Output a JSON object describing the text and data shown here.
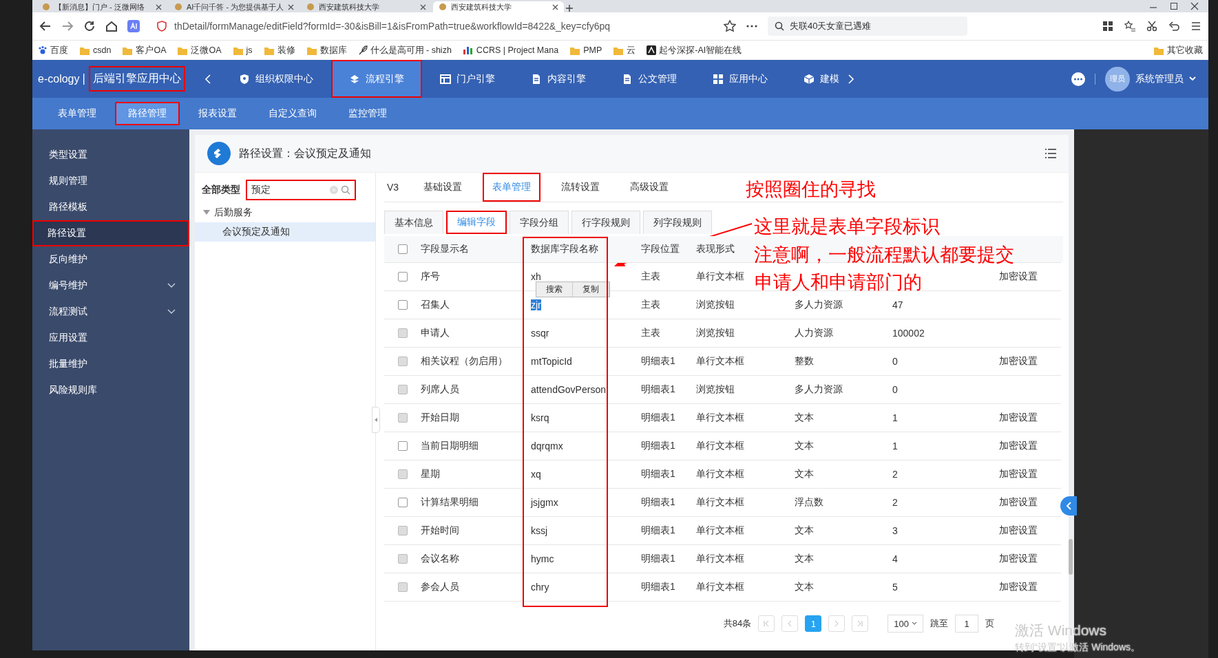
{
  "browser": {
    "tabs": [
      {
        "title": "【新消息】门户 - 泛微网络",
        "selected": false
      },
      {
        "title": "AI千问千答 - 为您提供基于人",
        "selected": false
      },
      {
        "title": "西安建筑科技大学",
        "selected": false
      },
      {
        "title": "西安建筑科技大学",
        "selected": true
      }
    ],
    "address": "thDetail/formManage/editField?formId=-30&isBill=1&isFromPath=true&workflowId=8422&_key=cfy6pq",
    "search": "失联40天女童已遇难",
    "bookmarks": [
      "百度",
      "csdn",
      "客户OA",
      "泛微OA",
      "js",
      "装修",
      "数据库",
      "什么是高可用 - shizh",
      "CCRS | Project Mana",
      "PMP",
      "云",
      "起兮深探-AI智能在线"
    ],
    "other_bookmarks": "其它收藏"
  },
  "app": {
    "brand": "e-cology",
    "center": "后端引擎应用中心",
    "center_circled": true,
    "nav": [
      {
        "label": "组织权限中心",
        "selected": false,
        "circled": false
      },
      {
        "label": "流程引擎",
        "selected": true,
        "circled": true
      },
      {
        "label": "门户引擎",
        "selected": false,
        "circled": false
      },
      {
        "label": "内容引擎",
        "selected": false,
        "circled": false
      },
      {
        "label": "公文管理",
        "selected": false,
        "circled": false
      },
      {
        "label": "应用中心",
        "selected": false,
        "circled": false
      },
      {
        "label": "建模",
        "selected": false,
        "circled": false
      }
    ],
    "avatar": "理员",
    "user": "系统管理员"
  },
  "subnav": [
    {
      "label": "表单管理",
      "selected": false,
      "circled": false
    },
    {
      "label": "路径管理",
      "selected": true,
      "circled": true
    },
    {
      "label": "报表设置",
      "selected": false,
      "circled": false
    },
    {
      "label": "自定义查询",
      "selected": false,
      "circled": false
    },
    {
      "label": "监控管理",
      "selected": false,
      "circled": false
    }
  ],
  "sidebar": [
    {
      "label": "类型设置",
      "selected": false,
      "expandable": false,
      "circled": false
    },
    {
      "label": "规则管理",
      "selected": false,
      "expandable": false,
      "circled": false
    },
    {
      "label": "路径模板",
      "selected": false,
      "expandable": false,
      "circled": false
    },
    {
      "label": "路径设置",
      "selected": true,
      "expandable": false,
      "circled": true
    },
    {
      "label": "反向维护",
      "selected": false,
      "expandable": false,
      "circled": false
    },
    {
      "label": "编号维护",
      "selected": false,
      "expandable": true,
      "circled": false
    },
    {
      "label": "流程测试",
      "selected": false,
      "expandable": true,
      "circled": false
    },
    {
      "label": "应用设置",
      "selected": false,
      "expandable": false,
      "circled": false
    },
    {
      "label": "批量维护",
      "selected": false,
      "expandable": false,
      "circled": false
    },
    {
      "label": "风险规则库",
      "selected": false,
      "expandable": false,
      "circled": false
    }
  ],
  "page_title": "路径设置：会议预定及通知",
  "tree": {
    "label": "全部类型",
    "search": "预定",
    "search_circled": true,
    "nodes": [
      {
        "label": "后勤服务",
        "expanded": true,
        "selected": false,
        "children": [
          {
            "label": "会议预定及通知",
            "selected": true
          }
        ]
      }
    ]
  },
  "version": "V3",
  "tabs": [
    {
      "label": "基础设置",
      "selected": false,
      "circled": false
    },
    {
      "label": "表单管理",
      "selected": true,
      "circled": true
    },
    {
      "label": "流转设置",
      "selected": false,
      "circled": false
    },
    {
      "label": "高级设置",
      "selected": false,
      "circled": false
    }
  ],
  "subtabs": [
    {
      "label": "基本信息",
      "selected": false,
      "circled": false
    },
    {
      "label": "编辑字段",
      "selected": true,
      "circled": true
    },
    {
      "label": "字段分组",
      "selected": false,
      "circled": false
    },
    {
      "label": "行字段规则",
      "selected": false,
      "circled": false
    },
    {
      "label": "列字段规则",
      "selected": false,
      "circled": false
    }
  ],
  "table": {
    "select_all": false,
    "columns": [
      {
        "label": "字段显示名",
        "circled": false
      },
      {
        "label": "数据库字段名称",
        "circled": true
      },
      {
        "label": "字段位置",
        "circled": false
      },
      {
        "label": "表现形式",
        "circled": false
      }
    ],
    "rows": [
      {
        "name": "序号",
        "db": "xh",
        "position": "主表",
        "form": "单行文本框",
        "action": "加密设置",
        "disabled": false,
        "text_selected": false
      },
      {
        "name": "召集人",
        "db": "zjr",
        "position": "主表",
        "form": "浏览按钮",
        "type": "多人力资源",
        "default": "47",
        "disabled": false,
        "text_selected": true
      },
      {
        "name": "申请人",
        "db": "ssqr",
        "position": "主表",
        "form": "浏览按钮",
        "type": "人力资源",
        "default": "100002",
        "disabled": true,
        "text_selected": false
      },
      {
        "name": "相关议程（勿启用）",
        "db": "mtTopicId",
        "position": "明细表1",
        "form": "单行文本框",
        "type": "整数",
        "default": "0",
        "action": "加密设置",
        "disabled": true,
        "text_selected": false
      },
      {
        "name": "列席人员",
        "db": "attendGovPerson",
        "position": "明细表1",
        "form": "浏览按钮",
        "type": "多人力资源",
        "default": "0",
        "disabled": true,
        "text_selected": false
      },
      {
        "name": "开始日期",
        "db": "ksrq",
        "position": "明细表1",
        "form": "单行文本框",
        "type": "文本",
        "default": "1",
        "action": "加密设置",
        "disabled": true,
        "text_selected": false
      },
      {
        "name": "当前日期明细",
        "db": "dqrqmx",
        "position": "明细表1",
        "form": "单行文本框",
        "type": "文本",
        "default": "1",
        "action": "加密设置",
        "disabled": false,
        "text_selected": false
      },
      {
        "name": "星期",
        "db": "xq",
        "position": "明细表1",
        "form": "单行文本框",
        "type": "文本",
        "default": "2",
        "action": "加密设置",
        "disabled": true,
        "text_selected": false
      },
      {
        "name": "计算结果明细",
        "db": "jsjgmx",
        "position": "明细表1",
        "form": "单行文本框",
        "type": "浮点数",
        "default": "2",
        "action": "加密设置",
        "disabled": false,
        "text_selected": false
      },
      {
        "name": "开始时间",
        "db": "kssj",
        "position": "明细表1",
        "form": "单行文本框",
        "type": "文本",
        "default": "3",
        "action": "加密设置",
        "disabled": true,
        "text_selected": false
      },
      {
        "name": "会议名称",
        "db": "hymc",
        "position": "明细表1",
        "form": "单行文本框",
        "type": "文本",
        "default": "4",
        "action": "加密设置",
        "disabled": true,
        "text_selected": false
      },
      {
        "name": "参会人员",
        "db": "chry",
        "position": "明细表1",
        "form": "单行文本框",
        "type": "文本",
        "default": "5",
        "action": "加密设置",
        "disabled": true,
        "text_selected": false
      }
    ]
  },
  "context_menu": [
    "搜索",
    "复制"
  ],
  "pagination": {
    "total": "共84条",
    "pages": [
      {
        "label": "1",
        "selected": true
      }
    ],
    "page_size": "100",
    "jump_label": "跳至",
    "jump_value": "1",
    "page_unit": "页"
  },
  "annotations": [
    "按照圈住的寻找",
    "这里就是表单字段标识",
    "注意啊，一般流程默认都要提交",
    "申请人和申请部门的"
  ],
  "os_notice": [
    "激活 Windows",
    "转到“设置”以激活 Windows。"
  ]
}
